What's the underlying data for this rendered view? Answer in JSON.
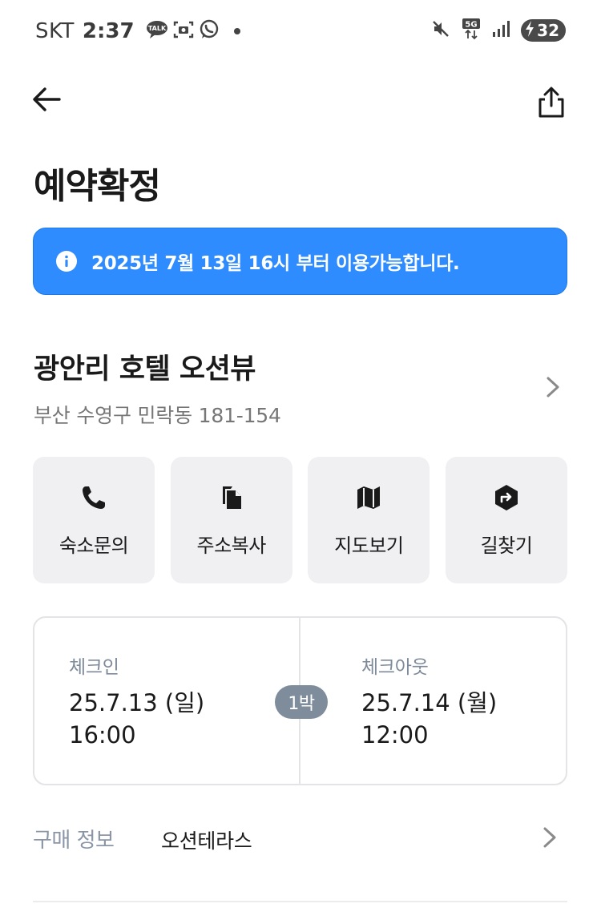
{
  "status_bar": {
    "carrier": "SKT",
    "time": "2:37",
    "notification_icons": [
      "talk-icon",
      "screenshot-icon",
      "whatsapp-icon"
    ],
    "network": "5G",
    "battery_level": "32"
  },
  "header": {
    "title": "예약확정"
  },
  "notice": {
    "text": "2025년 7월 13일 16시 부터 이용가능합니다.",
    "color": "#2f8cff"
  },
  "hotel": {
    "name": "광안리 호텔 오션뷰",
    "address": "부산 수영구 민락동 181-154"
  },
  "actions": [
    {
      "label": "숙소문의",
      "icon": "phone-icon"
    },
    {
      "label": "주소복사",
      "icon": "copy-icon"
    },
    {
      "label": "지도보기",
      "icon": "map-icon"
    },
    {
      "label": "길찾기",
      "icon": "directions-icon"
    }
  ],
  "stay": {
    "checkin": {
      "label": "체크인",
      "date": "25.7.13 (일)",
      "time": "16:00"
    },
    "checkout": {
      "label": "체크아웃",
      "date": "25.7.14 (월)",
      "time": "12:00"
    },
    "nights": "1박"
  },
  "purchase": {
    "label": "구매 정보",
    "value": "오션테라스"
  }
}
